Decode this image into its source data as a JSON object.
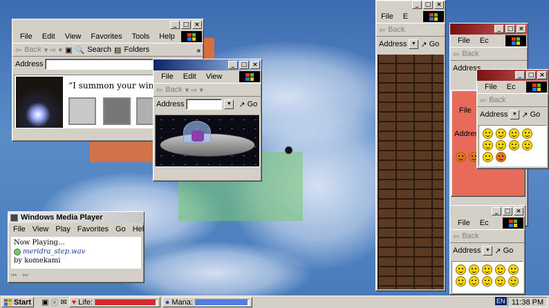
{
  "ie_menu": [
    "File",
    "Edit",
    "View",
    "Favorites",
    "Tools",
    "Help"
  ],
  "toolbar": {
    "back": "Back",
    "search": "Search",
    "folders": "Folders",
    "go": "Go"
  },
  "address_label": "Address",
  "window1": {
    "quote": "“I summon your window”"
  },
  "window2": {
    "menu": [
      "File",
      "Edit",
      "View"
    ]
  },
  "wmp": {
    "title": "Windows Media Player",
    "menu": [
      "File",
      "View",
      "Play",
      "Favorites",
      "Go",
      "Help"
    ],
    "now_playing": "Now Playing...",
    "file": "meridra_step.wav",
    "by": "by komekami"
  },
  "right_windows": {
    "w1_menu": [
      "File",
      "E"
    ],
    "w2_menu": [
      "File",
      "Ec"
    ],
    "w3_menu": [
      "File",
      "Ec"
    ],
    "w4_menu": [
      "File",
      "Ec"
    ],
    "w5_menu": [
      "File",
      "Ec"
    ]
  },
  "taskbar": {
    "start": "Start",
    "life_label": "Life:",
    "mana_label": "Mana:",
    "life_level": 0.98,
    "mana_level": 0.98,
    "lang": "EN",
    "time": "11:38 PM"
  },
  "colors": {
    "title_active": "#0a246a",
    "life": "#d42a2a",
    "mana": "#4f7fe0"
  }
}
